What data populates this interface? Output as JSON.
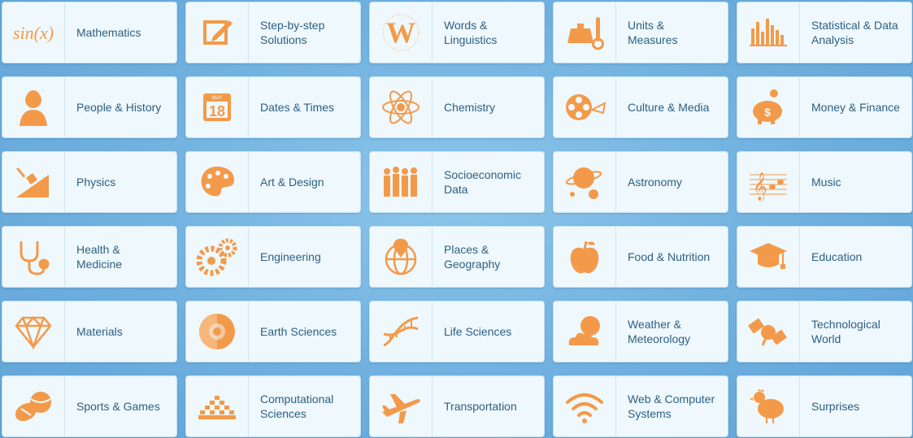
{
  "accent_color": "#f39a4a",
  "categories": [
    {
      "label": "Mathematics",
      "icon": "sin-x-icon"
    },
    {
      "label": "Step-by-step\nSolutions",
      "icon": "pencil-notepad-icon"
    },
    {
      "label": "Words &\nLinguistics",
      "icon": "letter-w-icon"
    },
    {
      "label": "Units &\nMeasures",
      "icon": "weight-thermometer-icon"
    },
    {
      "label": "Statistical & Data\nAnalysis",
      "icon": "bar-chart-icon"
    },
    {
      "label": "People & History",
      "icon": "historical-portrait-icon"
    },
    {
      "label": "Dates & Times",
      "icon": "calendar-icon"
    },
    {
      "label": "Chemistry",
      "icon": "atom-icon"
    },
    {
      "label": "Culture & Media",
      "icon": "film-reel-icon"
    },
    {
      "label": "Money & Finance",
      "icon": "piggy-bank-icon"
    },
    {
      "label": "Physics",
      "icon": "inclined-plane-icon"
    },
    {
      "label": "Art & Design",
      "icon": "paint-palette-icon"
    },
    {
      "label": "Socioeconomic\nData",
      "icon": "people-group-icon"
    },
    {
      "label": "Astronomy",
      "icon": "planets-icon"
    },
    {
      "label": "Music",
      "icon": "music-staff-icon"
    },
    {
      "label": "Health &\nMedicine",
      "icon": "stethoscope-icon"
    },
    {
      "label": "Engineering",
      "icon": "gears-icon"
    },
    {
      "label": "Places &\nGeography",
      "icon": "globe-pin-icon"
    },
    {
      "label": "Food & Nutrition",
      "icon": "apple-icon"
    },
    {
      "label": "Education",
      "icon": "graduation-cap-icon"
    },
    {
      "label": "Materials",
      "icon": "diamond-icon"
    },
    {
      "label": "Earth Sciences",
      "icon": "earth-layers-icon"
    },
    {
      "label": "Life Sciences",
      "icon": "dna-icon"
    },
    {
      "label": "Weather &\nMeteorology",
      "icon": "sun-cloud-icon"
    },
    {
      "label": "Technological\nWorld",
      "icon": "satellite-icon"
    },
    {
      "label": "Sports & Games",
      "icon": "sports-balls-icon"
    },
    {
      "label": "Computational\nSciences",
      "icon": "cellular-automaton-icon"
    },
    {
      "label": "Transportation",
      "icon": "airplane-icon"
    },
    {
      "label": "Web & Computer\nSystems",
      "icon": "wifi-icon"
    },
    {
      "label": "Surprises",
      "icon": "chicken-icon"
    }
  ]
}
